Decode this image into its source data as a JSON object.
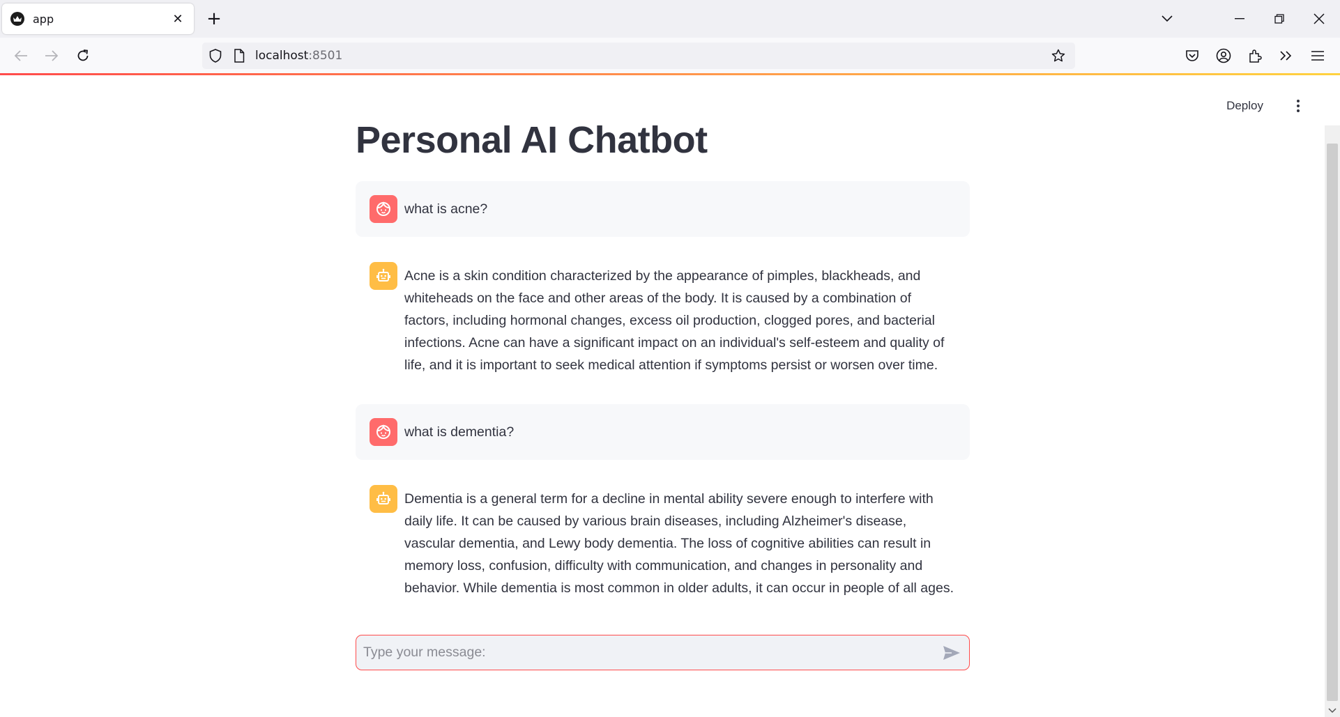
{
  "browser": {
    "tab_title": "app",
    "url_host": "localhost",
    "url_port": ":8501"
  },
  "app": {
    "deploy_label": "Deploy",
    "title": "Personal AI Chatbot",
    "messages": [
      {
        "role": "user",
        "text": "what is acne?"
      },
      {
        "role": "assistant",
        "text": "Acne is a skin condition characterized by the appearance of pimples, blackheads, and whiteheads on the face and other areas of the body. It is caused by a combination of factors, including hormonal changes, excess oil production, clogged pores, and bacterial infections. Acne can have a significant impact on an individual's self-esteem and quality of life, and it is important to seek medical attention if symptoms persist or worsen over time."
      },
      {
        "role": "user",
        "text": "what is dementia?"
      },
      {
        "role": "assistant",
        "text": "Dementia is a general term for a decline in mental ability severe enough to interfere with daily life. It can be caused by various brain diseases, including Alzheimer's disease, vascular dementia, and Lewy body dementia. The loss of cognitive abilities can result in memory loss, confusion, difficulty with communication, and changes in personality and behavior. While dementia is most common in older adults, it can occur in people of all ages."
      }
    ],
    "chat_input": {
      "placeholder": "Type your message:",
      "value": ""
    }
  },
  "colors": {
    "accent": "#ff4b4b",
    "user_avatar": "#ff6b6b",
    "bot_avatar": "#ffbd45",
    "text": "#31333f"
  },
  "icons": {
    "user_avatar": "face-icon",
    "bot_avatar": "robot-icon",
    "send": "send-icon"
  }
}
